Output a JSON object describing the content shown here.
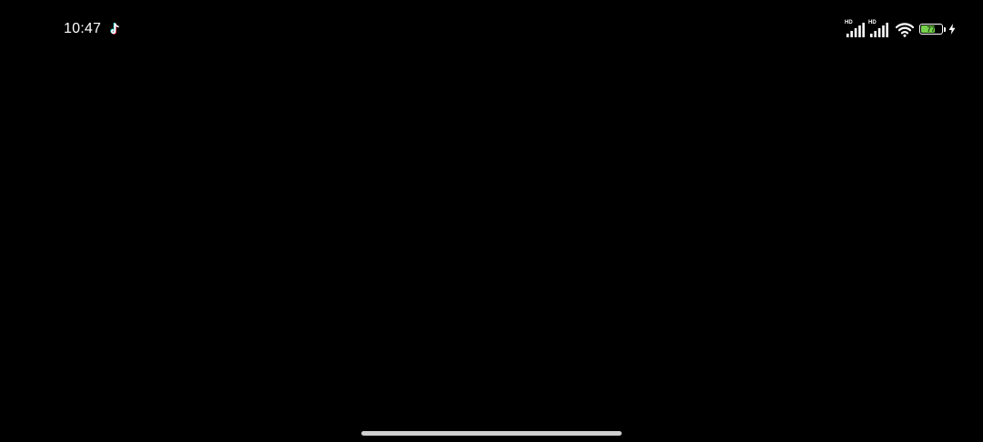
{
  "status_bar": {
    "time": "10:47",
    "notification_icon": "tiktok-icon",
    "sim1": {
      "badge": "HD",
      "icon": "cellular-signal-icon"
    },
    "sim2": {
      "badge": "HD",
      "icon": "cellular-signal-icon"
    },
    "wifi_icon": "wifi-icon",
    "battery": {
      "level_text": "77",
      "level_percent": 77,
      "fill_color": "#76d24c",
      "charging": true
    }
  },
  "theme": {
    "background": "#000000",
    "foreground": "#ffffff",
    "home_indicator_color": "#cfcfcf"
  }
}
